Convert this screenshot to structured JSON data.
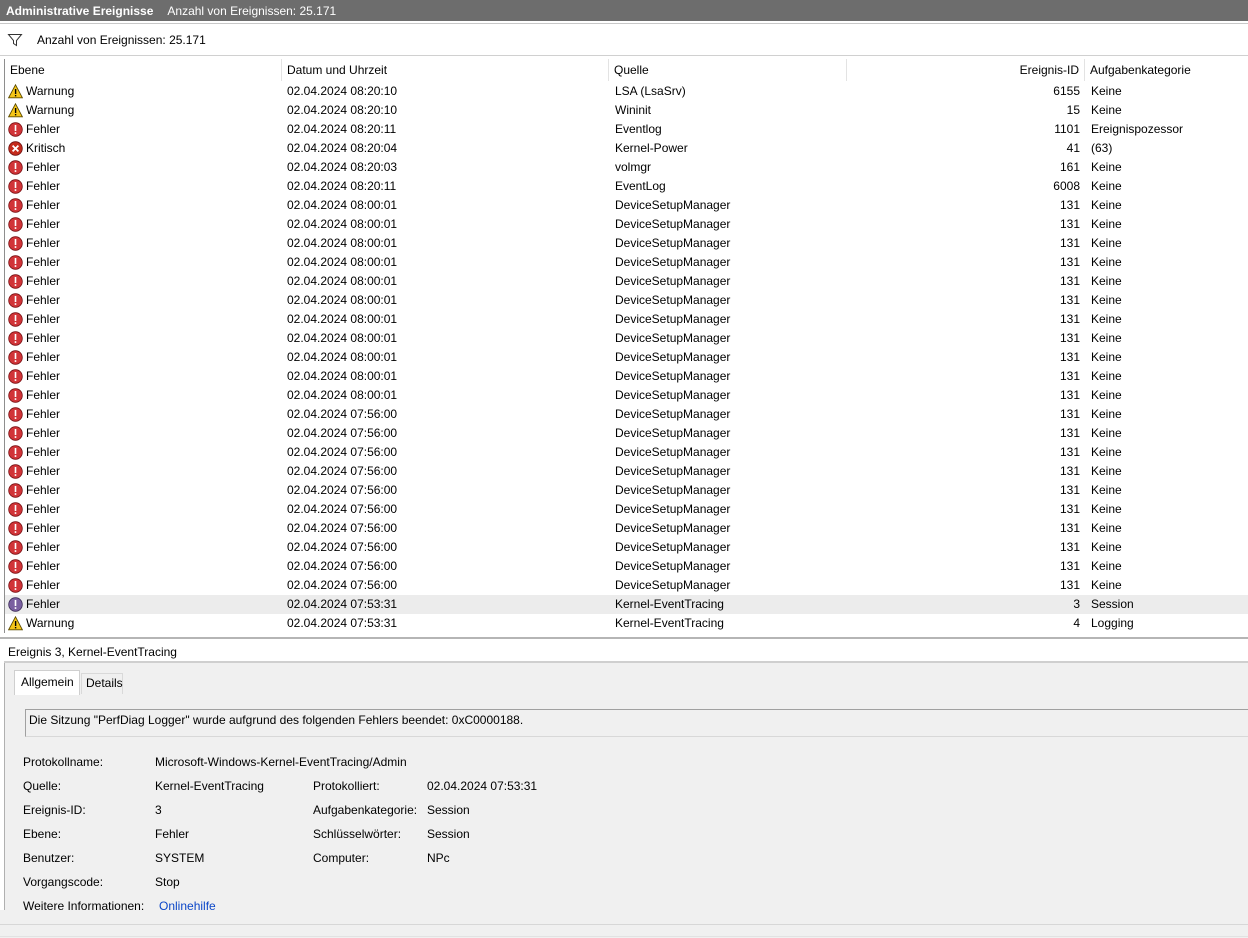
{
  "window": {
    "title": "Administrative Ereignisse",
    "count_text": "Anzahl von Ereignissen: 25.171"
  },
  "filter": {
    "icon": "filter-icon",
    "text": "Anzahl von Ereignissen: 25.171"
  },
  "columns": {
    "level": "Ebene",
    "date": "Datum und Uhrzeit",
    "source": "Quelle",
    "event_id": "Ereignis-ID",
    "category": "Aufgabenkategorie"
  },
  "colors": {
    "warning": "#f5c518",
    "error": "#d13438",
    "critical": "#c42b1c",
    "selected_row": "#ececec",
    "link": "#0b46c8",
    "titlebar": "#6d6d6d"
  },
  "events": [
    {
      "icon": "warning",
      "level": "Warnung",
      "date": "02.04.2024 08:20:10",
      "source": "LSA (LsaSrv)",
      "id": "6155",
      "category": "Keine"
    },
    {
      "icon": "warning",
      "level": "Warnung",
      "date": "02.04.2024 08:20:10",
      "source": "Wininit",
      "id": "15",
      "category": "Keine"
    },
    {
      "icon": "error",
      "level": "Fehler",
      "date": "02.04.2024 08:20:11",
      "source": "Eventlog",
      "id": "1101",
      "category": "Ereignispozessor"
    },
    {
      "icon": "critical",
      "level": "Kritisch",
      "date": "02.04.2024 08:20:04",
      "source": "Kernel-Power",
      "id": "41",
      "category": "(63)"
    },
    {
      "icon": "error",
      "level": "Fehler",
      "date": "02.04.2024 08:20:03",
      "source": "volmgr",
      "id": "161",
      "category": "Keine"
    },
    {
      "icon": "error",
      "level": "Fehler",
      "date": "02.04.2024 08:20:11",
      "source": "EventLog",
      "id": "6008",
      "category": "Keine"
    },
    {
      "icon": "error",
      "level": "Fehler",
      "date": "02.04.2024 08:00:01",
      "source": "DeviceSetupManager",
      "id": "131",
      "category": "Keine"
    },
    {
      "icon": "error",
      "level": "Fehler",
      "date": "02.04.2024 08:00:01",
      "source": "DeviceSetupManager",
      "id": "131",
      "category": "Keine"
    },
    {
      "icon": "error",
      "level": "Fehler",
      "date": "02.04.2024 08:00:01",
      "source": "DeviceSetupManager",
      "id": "131",
      "category": "Keine"
    },
    {
      "icon": "error",
      "level": "Fehler",
      "date": "02.04.2024 08:00:01",
      "source": "DeviceSetupManager",
      "id": "131",
      "category": "Keine"
    },
    {
      "icon": "error",
      "level": "Fehler",
      "date": "02.04.2024 08:00:01",
      "source": "DeviceSetupManager",
      "id": "131",
      "category": "Keine"
    },
    {
      "icon": "error",
      "level": "Fehler",
      "date": "02.04.2024 08:00:01",
      "source": "DeviceSetupManager",
      "id": "131",
      "category": "Keine"
    },
    {
      "icon": "error",
      "level": "Fehler",
      "date": "02.04.2024 08:00:01",
      "source": "DeviceSetupManager",
      "id": "131",
      "category": "Keine"
    },
    {
      "icon": "error",
      "level": "Fehler",
      "date": "02.04.2024 08:00:01",
      "source": "DeviceSetupManager",
      "id": "131",
      "category": "Keine"
    },
    {
      "icon": "error",
      "level": "Fehler",
      "date": "02.04.2024 08:00:01",
      "source": "DeviceSetupManager",
      "id": "131",
      "category": "Keine"
    },
    {
      "icon": "error",
      "level": "Fehler",
      "date": "02.04.2024 08:00:01",
      "source": "DeviceSetupManager",
      "id": "131",
      "category": "Keine"
    },
    {
      "icon": "error",
      "level": "Fehler",
      "date": "02.04.2024 08:00:01",
      "source": "DeviceSetupManager",
      "id": "131",
      "category": "Keine"
    },
    {
      "icon": "error",
      "level": "Fehler",
      "date": "02.04.2024 07:56:00",
      "source": "DeviceSetupManager",
      "id": "131",
      "category": "Keine"
    },
    {
      "icon": "error",
      "level": "Fehler",
      "date": "02.04.2024 07:56:00",
      "source": "DeviceSetupManager",
      "id": "131",
      "category": "Keine"
    },
    {
      "icon": "error",
      "level": "Fehler",
      "date": "02.04.2024 07:56:00",
      "source": "DeviceSetupManager",
      "id": "131",
      "category": "Keine"
    },
    {
      "icon": "error",
      "level": "Fehler",
      "date": "02.04.2024 07:56:00",
      "source": "DeviceSetupManager",
      "id": "131",
      "category": "Keine"
    },
    {
      "icon": "error",
      "level": "Fehler",
      "date": "02.04.2024 07:56:00",
      "source": "DeviceSetupManager",
      "id": "131",
      "category": "Keine"
    },
    {
      "icon": "error",
      "level": "Fehler",
      "date": "02.04.2024 07:56:00",
      "source": "DeviceSetupManager",
      "id": "131",
      "category": "Keine"
    },
    {
      "icon": "error",
      "level": "Fehler",
      "date": "02.04.2024 07:56:00",
      "source": "DeviceSetupManager",
      "id": "131",
      "category": "Keine"
    },
    {
      "icon": "error",
      "level": "Fehler",
      "date": "02.04.2024 07:56:00",
      "source": "DeviceSetupManager",
      "id": "131",
      "category": "Keine"
    },
    {
      "icon": "error",
      "level": "Fehler",
      "date": "02.04.2024 07:56:00",
      "source": "DeviceSetupManager",
      "id": "131",
      "category": "Keine"
    },
    {
      "icon": "error",
      "level": "Fehler",
      "date": "02.04.2024 07:56:00",
      "source": "DeviceSetupManager",
      "id": "131",
      "category": "Keine"
    },
    {
      "icon": "error",
      "level": "Fehler",
      "date": "02.04.2024 07:53:31",
      "source": "Kernel-EventTracing",
      "id": "3",
      "category": "Session",
      "selected": true
    },
    {
      "icon": "warning",
      "level": "Warnung",
      "date": "02.04.2024 07:53:31",
      "source": "Kernel-EventTracing",
      "id": "4",
      "category": "Logging"
    }
  ],
  "detail": {
    "title": "Ereignis 3, Kernel-EventTracing",
    "tabs": [
      "Allgemein",
      "Details"
    ],
    "message": "Die Sitzung \"PerfDiag Logger\" wurde aufgrund des folgenden Fehlers beendet: 0xC0000188.",
    "labels": {
      "log_name": "Protokollname:",
      "source": "Quelle:",
      "event_id": "Ereignis-ID:",
      "level": "Ebene:",
      "user": "Benutzer:",
      "opcode": "Vorgangscode:",
      "more_info": "Weitere Informationen:",
      "logged": "Protokolliert:",
      "task_category": "Aufgabenkategorie:",
      "keywords": "Schlüsselwörter:",
      "computer": "Computer:"
    },
    "values": {
      "log_name": "Microsoft-Windows-Kernel-EventTracing/Admin",
      "source": "Kernel-EventTracing",
      "event_id": "3",
      "level": "Fehler",
      "user": "SYSTEM",
      "opcode": "Stop",
      "more_info": "Onlinehilfe",
      "logged": "02.04.2024 07:53:31",
      "task_category": "Session",
      "keywords": "Session",
      "computer": "NPc"
    }
  }
}
